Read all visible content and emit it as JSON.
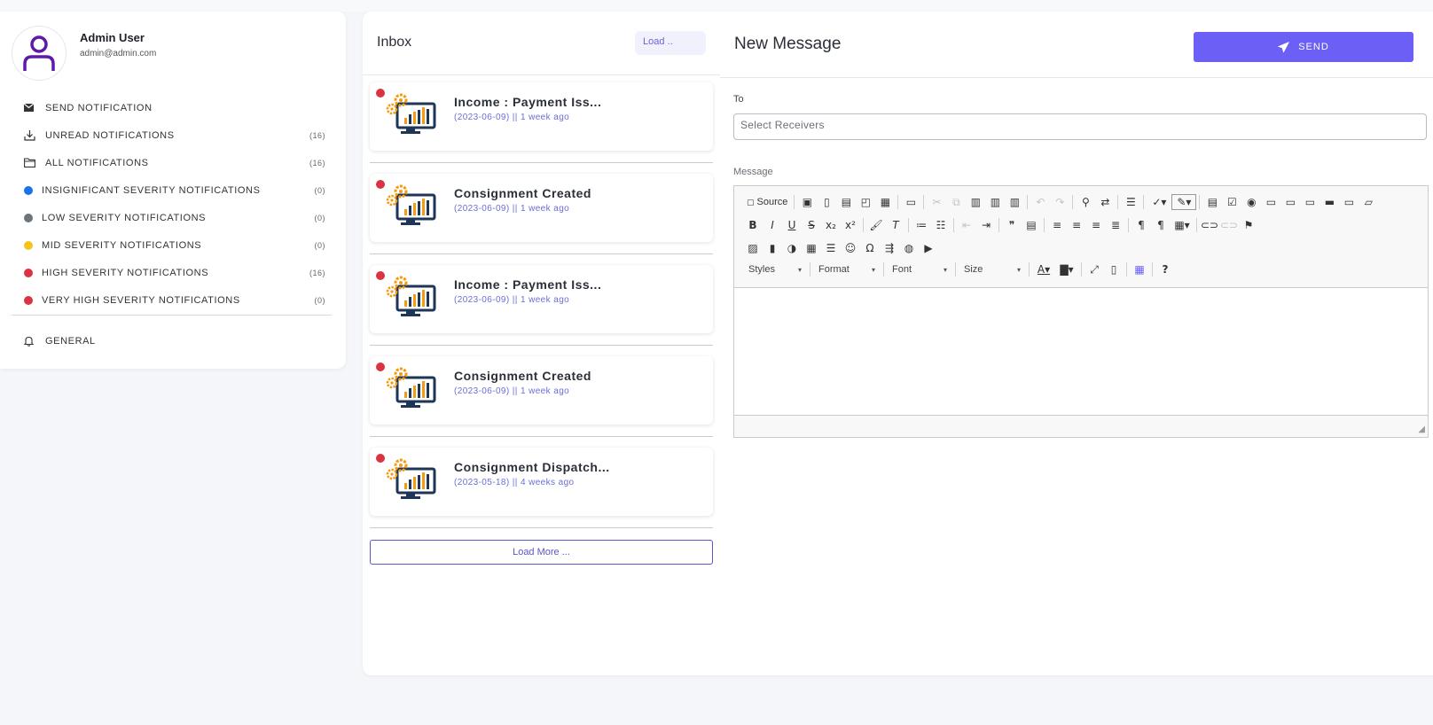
{
  "profile": {
    "name": "Admin User",
    "email": "admin@admin.com"
  },
  "sidebar": {
    "items": [
      {
        "label": "SEND NOTIFICATION",
        "count": "",
        "icon": "envelope-icon"
      },
      {
        "label": "UNREAD NOTIFICATIONS",
        "count": "(16)",
        "icon": "download-icon"
      },
      {
        "label": "ALL NOTIFICATIONS",
        "count": "(16)",
        "icon": "folder-icon"
      },
      {
        "label": "INSIGNIFICANT SEVERITY NOTIFICATIONS",
        "count": "(0)",
        "color": "#1a73e8"
      },
      {
        "label": "LOW SEVERITY NOTIFICATIONS",
        "count": "(0)",
        "color": "#6c757d"
      },
      {
        "label": "MID SEVERITY NOTIFICATIONS",
        "count": "(0)",
        "color": "#f5c419"
      },
      {
        "label": "HIGH SEVERITY NOTIFICATIONS",
        "count": "(16)",
        "color": "#d9343f"
      },
      {
        "label": "VERY HIGH SEVERITY NOTIFICATIONS",
        "count": "(0)",
        "color": "#d9343f"
      }
    ],
    "general": {
      "label": "GENERAL",
      "icon": "bell-icon"
    }
  },
  "inbox": {
    "title": "Inbox",
    "load_label": "Load ..",
    "load_more_label": "Load More ...",
    "messages": [
      {
        "title": "Income : Payment Iss...",
        "meta": "(2023-06-09) || 1 week ago"
      },
      {
        "title": "Consignment Created",
        "meta": "(2023-06-09) || 1 week ago"
      },
      {
        "title": "Income : Payment Iss...",
        "meta": "(2023-06-09) || 1 week ago"
      },
      {
        "title": "Consignment Created",
        "meta": "(2023-06-09) || 1 week ago"
      },
      {
        "title": "Consignment Dispatch...",
        "meta": "(2023-05-18) || 4 weeks ago"
      }
    ]
  },
  "compose": {
    "title": "New Message",
    "send_label": "SEND",
    "to_label": "To",
    "to_placeholder": "Select Receivers",
    "message_label": "Message",
    "editor": {
      "source_label": "Source",
      "styles_label": "Styles",
      "format_label": "Format",
      "font_label": "Font",
      "size_label": "Size"
    }
  },
  "colors": {
    "accent": "#6c5ff5",
    "unread_dot": "#d9343f",
    "link": "#6a6fd6"
  }
}
